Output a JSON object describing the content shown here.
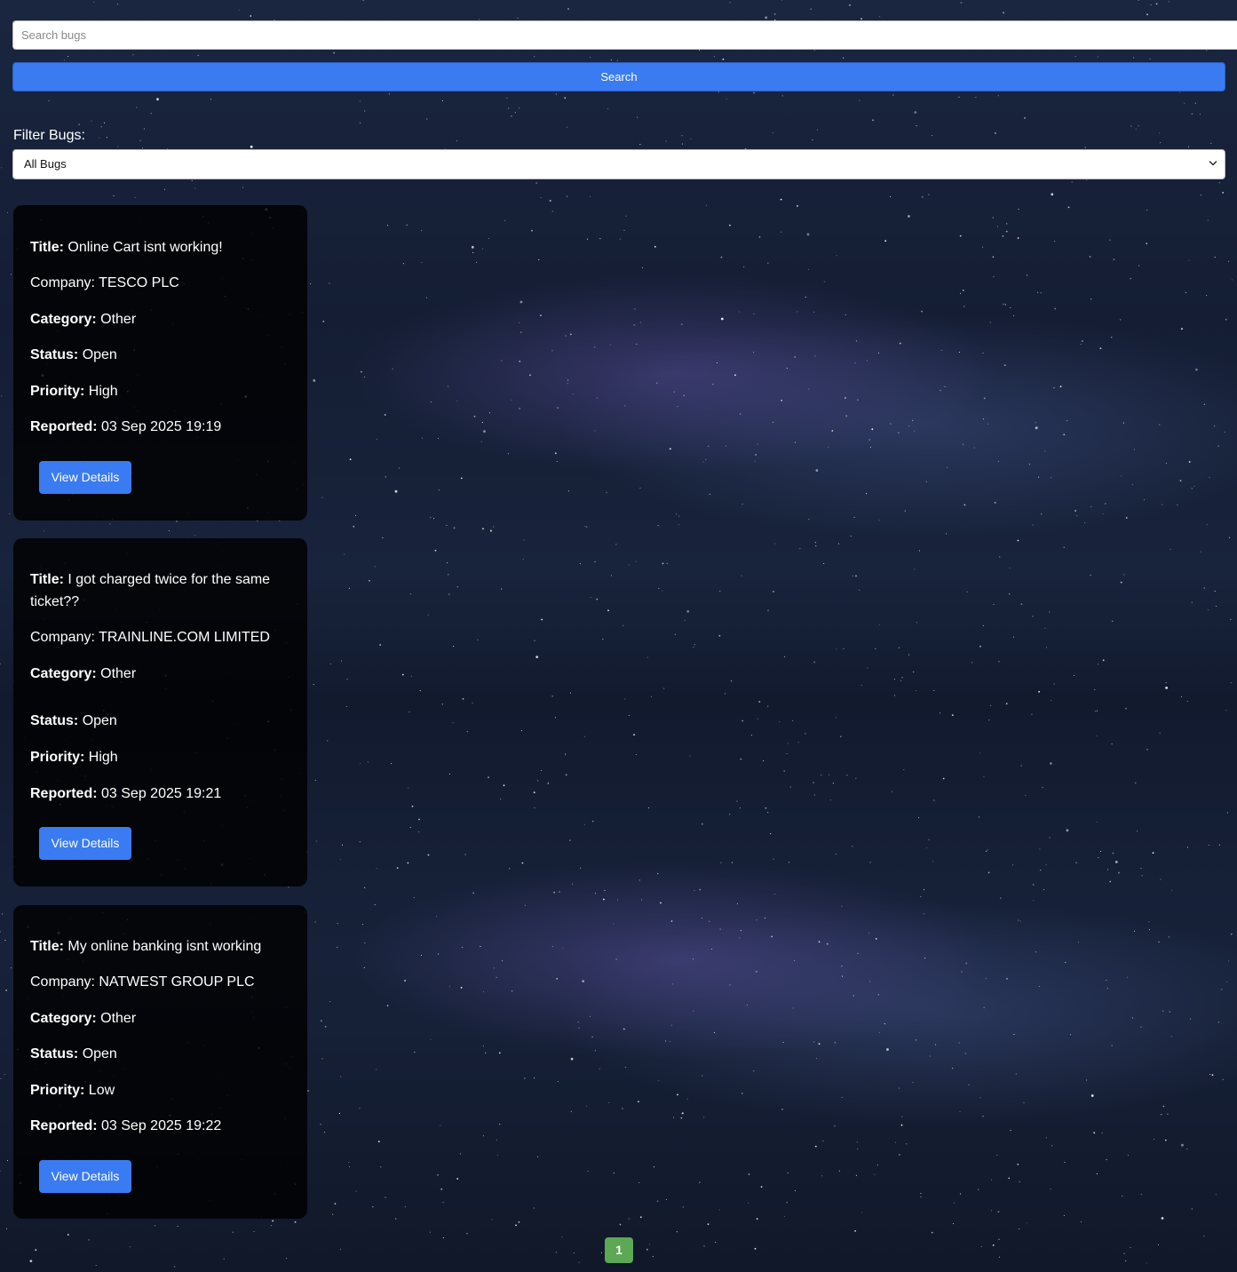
{
  "search": {
    "placeholder": "Search bugs",
    "button_label": "Search"
  },
  "filter": {
    "label": "Filter Bugs:",
    "selected": "All Bugs",
    "icon": "chevron-down-icon"
  },
  "labels": {
    "title": "Title:",
    "company": "Company:",
    "category": "Category:",
    "status": "Status:",
    "priority": "Priority:",
    "reported": "Reported:"
  },
  "bugs": [
    {
      "title": "Online Cart isnt working!",
      "company": "TESCO PLC",
      "category": "Other",
      "status": "Open",
      "priority": "High",
      "reported": "03 Sep 2025 19:19",
      "button_label": "View Details"
    },
    {
      "title": "I got charged twice for the same ticket??",
      "company": "TRAINLINE.COM LIMITED",
      "category": "Other",
      "status": "Open",
      "priority": "High",
      "reported": "03 Sep 2025 19:21",
      "button_label": "View Details"
    },
    {
      "title": "My online banking isnt working",
      "company": "NATWEST GROUP PLC",
      "category": "Other",
      "status": "Open",
      "priority": "Low",
      "reported": "03 Sep 2025 19:22",
      "button_label": "View Details"
    }
  ],
  "pagination": {
    "current_page": "1"
  },
  "colors": {
    "accent": "#3a7bf2",
    "page_active": "#5ca854",
    "card_bg": "#000000"
  }
}
